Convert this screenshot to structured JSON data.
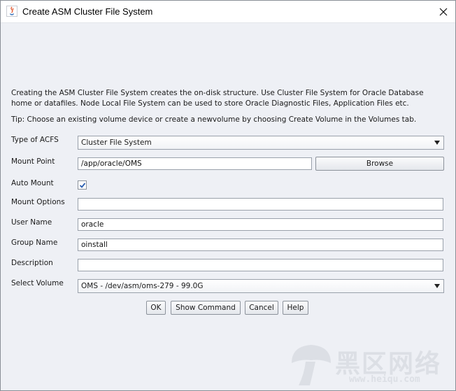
{
  "window": {
    "title": "Create ASM Cluster File System",
    "icon": "java-icon",
    "close_icon": "close-icon"
  },
  "intro": {
    "line1": "Creating the ASM Cluster File System creates the on-disk structure. Use Cluster File System for Oracle Database",
    "line2": "home or datafiles. Node Local File System can be used to store Oracle Diagnostic Files, Application Files etc.",
    "tip": "Tip: Choose an existing volume device or create a newvolume by choosing Create Volume in the Volumes tab."
  },
  "form": {
    "type_label": "Type of ACFS",
    "type_value": "Cluster File System",
    "mount_point_label": "Mount Point",
    "mount_point_value": "/app/oracle/OMS",
    "browse_label": "Browse",
    "auto_mount_label": "Auto Mount",
    "auto_mount_checked": true,
    "mount_options_label": "Mount Options",
    "mount_options_value": "",
    "user_name_label": "User Name",
    "user_name_value": "oracle",
    "group_name_label": "Group Name",
    "group_name_value": "oinstall",
    "description_label": "Description",
    "description_value": "",
    "select_volume_label": "Select Volume",
    "select_volume_value": "OMS - /dev/asm/oms-279 - 99.0G"
  },
  "buttons": {
    "ok": "OK",
    "show_command": "Show Command",
    "cancel": "Cancel",
    "help": "Help"
  },
  "watermark": {
    "brand": "黑区网络",
    "url": "www.heiqu.com"
  },
  "colors": {
    "dialog_bg": "#eef0f5",
    "field_border": "#9aa1ab",
    "check_color": "#2a5db0"
  }
}
